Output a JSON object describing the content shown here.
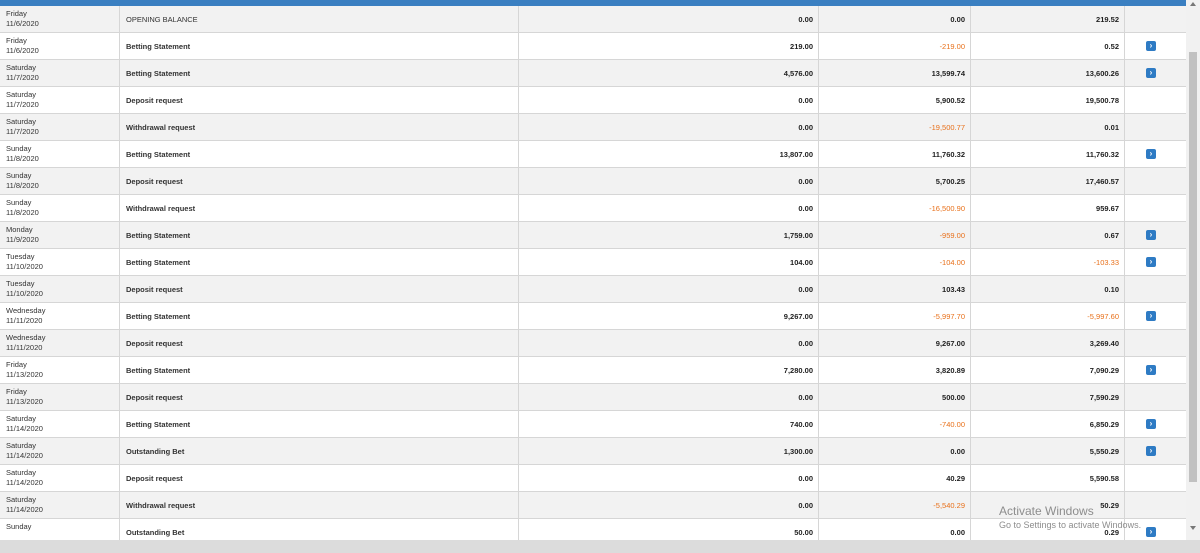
{
  "transactions": [
    {
      "day": "Friday",
      "date": "11/6/2020",
      "type": "OPENING BALANCE",
      "amount": "0.00",
      "change": "0.00",
      "balance": "219.52",
      "change_neg": false,
      "balance_neg": false,
      "has_action": false
    },
    {
      "day": "Friday",
      "date": "11/6/2020",
      "type": "Betting Statement",
      "amount": "219.00",
      "change": "-219.00",
      "balance": "0.52",
      "change_neg": true,
      "balance_neg": false,
      "has_action": true
    },
    {
      "day": "Saturday",
      "date": "11/7/2020",
      "type": "Betting Statement",
      "amount": "4,576.00",
      "change": "13,599.74",
      "balance": "13,600.26",
      "change_neg": false,
      "balance_neg": false,
      "has_action": true
    },
    {
      "day": "Saturday",
      "date": "11/7/2020",
      "type": "Deposit request",
      "amount": "0.00",
      "change": "5,900.52",
      "balance": "19,500.78",
      "change_neg": false,
      "balance_neg": false,
      "has_action": false
    },
    {
      "day": "Saturday",
      "date": "11/7/2020",
      "type": "Withdrawal request",
      "amount": "0.00",
      "change": "-19,500.77",
      "balance": "0.01",
      "change_neg": true,
      "balance_neg": false,
      "has_action": false
    },
    {
      "day": "Sunday",
      "date": "11/8/2020",
      "type": "Betting Statement",
      "amount": "13,807.00",
      "change": "11,760.32",
      "balance": "11,760.32",
      "change_neg": false,
      "balance_neg": false,
      "has_action": true
    },
    {
      "day": "Sunday",
      "date": "11/8/2020",
      "type": "Deposit request",
      "amount": "0.00",
      "change": "5,700.25",
      "balance": "17,460.57",
      "change_neg": false,
      "balance_neg": false,
      "has_action": false
    },
    {
      "day": "Sunday",
      "date": "11/8/2020",
      "type": "Withdrawal request",
      "amount": "0.00",
      "change": "-16,500.90",
      "balance": "959.67",
      "change_neg": true,
      "balance_neg": false,
      "has_action": false
    },
    {
      "day": "Monday",
      "date": "11/9/2020",
      "type": "Betting Statement",
      "amount": "1,759.00",
      "change": "-959.00",
      "balance": "0.67",
      "change_neg": true,
      "balance_neg": false,
      "has_action": true
    },
    {
      "day": "Tuesday",
      "date": "11/10/2020",
      "type": "Betting Statement",
      "amount": "104.00",
      "change": "-104.00",
      "balance": "-103.33",
      "change_neg": true,
      "balance_neg": true,
      "has_action": true
    },
    {
      "day": "Tuesday",
      "date": "11/10/2020",
      "type": "Deposit request",
      "amount": "0.00",
      "change": "103.43",
      "balance": "0.10",
      "change_neg": false,
      "balance_neg": false,
      "has_action": false
    },
    {
      "day": "Wednesday",
      "date": "11/11/2020",
      "type": "Betting Statement",
      "amount": "9,267.00",
      "change": "-5,997.70",
      "balance": "-5,997.60",
      "change_neg": true,
      "balance_neg": true,
      "has_action": true
    },
    {
      "day": "Wednesday",
      "date": "11/11/2020",
      "type": "Deposit request",
      "amount": "0.00",
      "change": "9,267.00",
      "balance": "3,269.40",
      "change_neg": false,
      "balance_neg": false,
      "has_action": false
    },
    {
      "day": "Friday",
      "date": "11/13/2020",
      "type": "Betting Statement",
      "amount": "7,280.00",
      "change": "3,820.89",
      "balance": "7,090.29",
      "change_neg": false,
      "balance_neg": false,
      "has_action": true
    },
    {
      "day": "Friday",
      "date": "11/13/2020",
      "type": "Deposit request",
      "amount": "0.00",
      "change": "500.00",
      "balance": "7,590.29",
      "change_neg": false,
      "balance_neg": false,
      "has_action": false
    },
    {
      "day": "Saturday",
      "date": "11/14/2020",
      "type": "Betting Statement",
      "amount": "740.00",
      "change": "-740.00",
      "balance": "6,850.29",
      "change_neg": true,
      "balance_neg": false,
      "has_action": true
    },
    {
      "day": "Saturday",
      "date": "11/14/2020",
      "type": "Outstanding Bet",
      "amount": "1,300.00",
      "change": "0.00",
      "balance": "5,550.29",
      "change_neg": false,
      "balance_neg": false,
      "has_action": true
    },
    {
      "day": "Saturday",
      "date": "11/14/2020",
      "type": "Deposit request",
      "amount": "0.00",
      "change": "40.29",
      "balance": "5,590.58",
      "change_neg": false,
      "balance_neg": false,
      "has_action": false
    },
    {
      "day": "Saturday",
      "date": "11/14/2020",
      "type": "Withdrawal request",
      "amount": "0.00",
      "change": "-5,540.29",
      "balance": "50.29",
      "change_neg": true,
      "balance_neg": false,
      "has_action": false
    },
    {
      "day": "Sunday",
      "date": "",
      "type": "Outstanding Bet",
      "amount": "50.00",
      "change": "0.00",
      "balance": "0.29",
      "change_neg": false,
      "balance_neg": false,
      "has_action": true
    }
  ],
  "action_icon": "chevron-right-icon",
  "action_glyph": "›",
  "watermark": {
    "line1": "Activate Windows",
    "line2": "Go to Settings to activate Windows."
  },
  "colors": {
    "accent": "#3a7fc1",
    "negative": "#e8701a",
    "button": "#2e7bc4"
  }
}
